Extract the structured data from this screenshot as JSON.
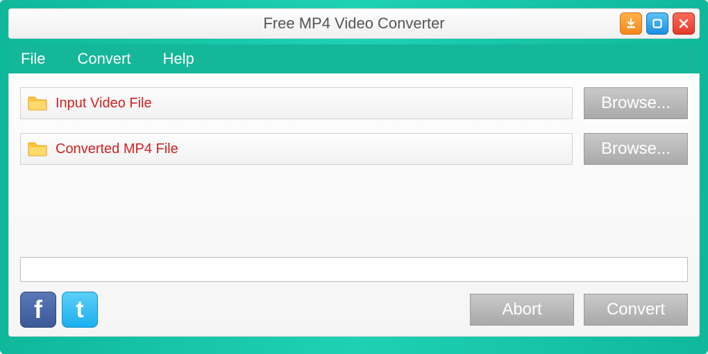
{
  "window": {
    "title": "Free MP4 Video Converter"
  },
  "menubar": {
    "file": "File",
    "convert": "Convert",
    "help": "Help"
  },
  "inputRow": {
    "label": "Input Video File",
    "browse": "Browse..."
  },
  "outputRow": {
    "label": "Converted MP4 File",
    "browse": "Browse..."
  },
  "actions": {
    "abort": "Abort",
    "convert": "Convert"
  },
  "social": {
    "facebook": "f",
    "twitter": "t"
  }
}
